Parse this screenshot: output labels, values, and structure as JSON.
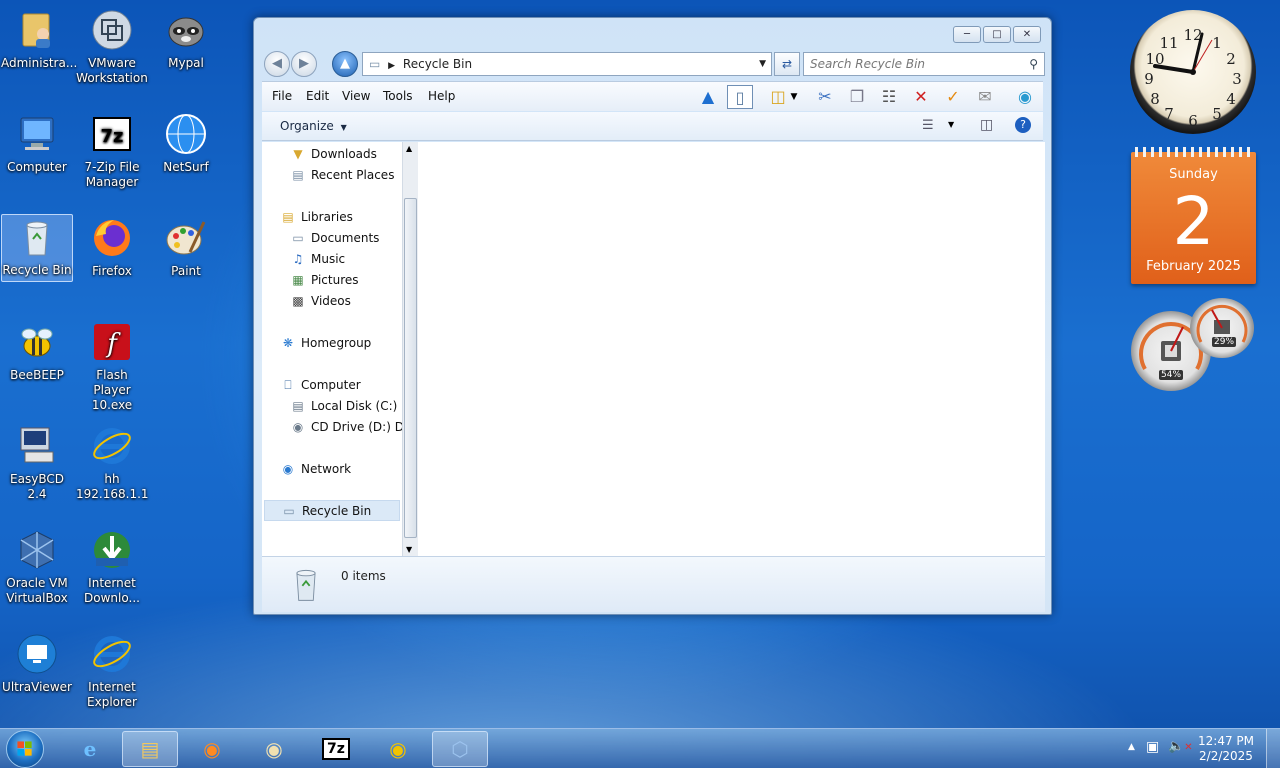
{
  "desktop": {
    "icons": [
      {
        "label": "Administra..."
      },
      {
        "label": "VMware Workstation"
      },
      {
        "label": "Mypal"
      },
      {
        "label": "Computer"
      },
      {
        "label": "7-Zip File Manager"
      },
      {
        "label": "NetSurf"
      },
      {
        "label": "Recycle Bin"
      },
      {
        "label": "Firefox"
      },
      {
        "label": "Paint"
      },
      {
        "label": "BeeBEEP"
      },
      {
        "label": "Flash Player 10.exe"
      },
      {
        "label": "EasyBCD 2.4"
      },
      {
        "label": "hh 192.168.1.1"
      },
      {
        "label": "Oracle VM VirtualBox"
      },
      {
        "label": "Internet Downlo..."
      },
      {
        "label": "UltraViewer"
      },
      {
        "label": "Internet Explorer"
      }
    ]
  },
  "window": {
    "address": "Recycle Bin",
    "search_placeholder": "Search Recycle Bin",
    "menu": [
      "File",
      "Edit",
      "View",
      "Tools",
      "Help"
    ],
    "organize": "Organize",
    "nav_tree": [
      {
        "label": "Downloads"
      },
      {
        "label": "Recent Places"
      },
      {
        "label": "Libraries"
      },
      {
        "label": "Documents"
      },
      {
        "label": "Music"
      },
      {
        "label": "Pictures"
      },
      {
        "label": "Videos"
      },
      {
        "label": "Homegroup"
      },
      {
        "label": "Computer"
      },
      {
        "label": "Local Disk (C:)"
      },
      {
        "label": "CD Drive (D:) Dre"
      },
      {
        "label": "Network"
      },
      {
        "label": "Recycle Bin"
      }
    ],
    "status": "0 items"
  },
  "gadgets": {
    "calendar": {
      "weekday": "Sunday",
      "day": "2",
      "month_year": "February 2025"
    },
    "cpu_meter": {
      "cpu": "54%",
      "ram": "29%"
    }
  },
  "taskbar": {
    "time": "12:47 PM",
    "date": "2/2/2025"
  },
  "colors": {
    "calendar_orange": "#e8701f",
    "window_chrome": "#cfe3f7",
    "desktop_blue": "#1565c8"
  }
}
